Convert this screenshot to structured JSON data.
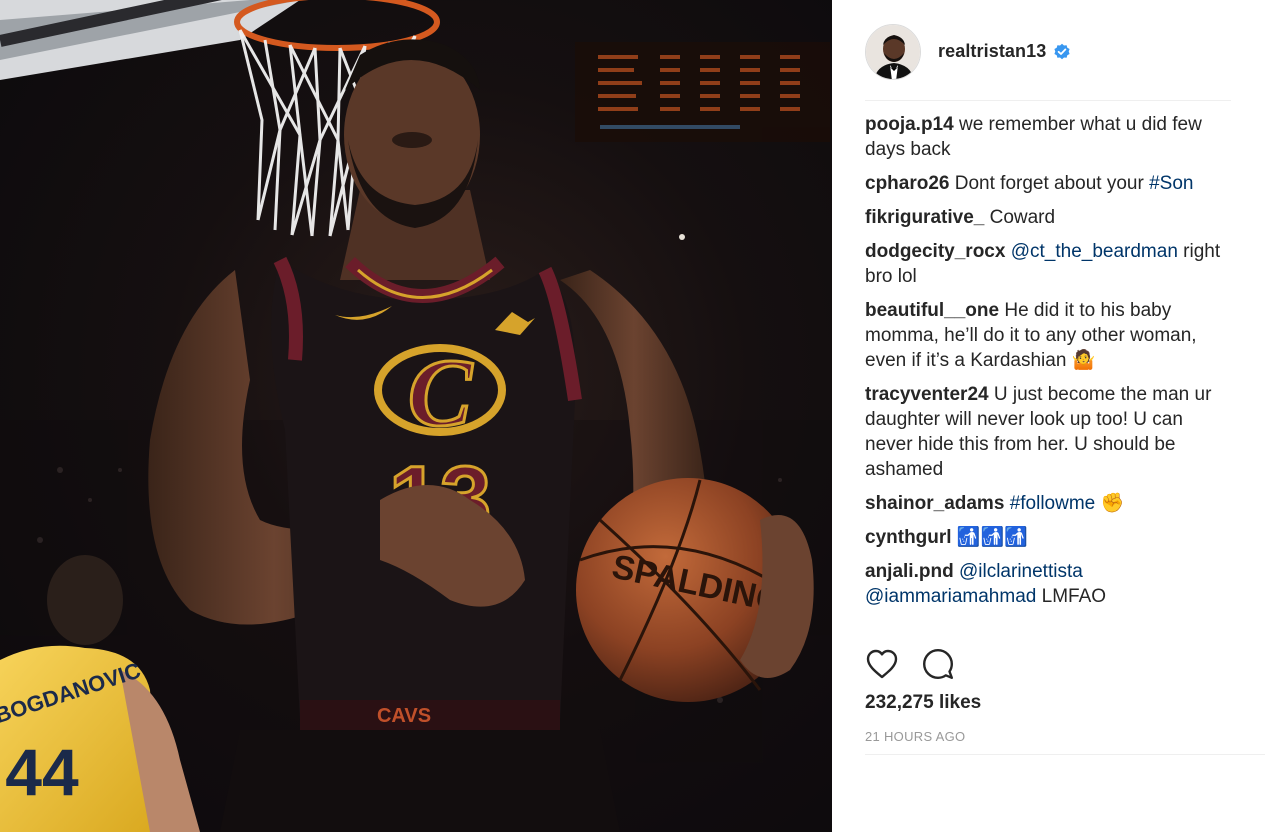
{
  "post": {
    "username": "realtristan13",
    "verified": true,
    "verified_icon": "verified-badge-icon",
    "likes": "232,275 likes",
    "time": "21 HOURS AGO",
    "photo": {
      "jersey_number": "13",
      "jersey_logo": "C",
      "shorts_text": "CAVS",
      "ball_brand": "SPALDING",
      "opponent_name": "BOGDANOVIC",
      "opponent_number": "44"
    }
  },
  "comments": [
    {
      "user": "pooja.p14",
      "parts": [
        {
          "t": "we remember what u did few days back"
        }
      ]
    },
    {
      "user": "cpharo26",
      "parts": [
        {
          "t": "Dont forget about your "
        },
        {
          "t": "#Son",
          "link": true
        }
      ]
    },
    {
      "user": "fikrigurative_",
      "parts": [
        {
          "t": "Coward"
        }
      ]
    },
    {
      "user": "dodgecity_rocx",
      "parts": [
        {
          "t": "@ct_the_beardman",
          "link": true
        },
        {
          "t": " right bro lol"
        }
      ]
    },
    {
      "user": "beautiful__one",
      "parts": [
        {
          "t": "He did it to his baby momma, he’ll do it to any other woman, even if it’s a Kardashian 🤷"
        }
      ]
    },
    {
      "user": "tracyventer24",
      "parts": [
        {
          "t": "U just become the man ur daughter will never look up too! U can never hide this from her. U should be ashamed"
        }
      ]
    },
    {
      "user": "shainor_adams",
      "parts": [
        {
          "t": "#followme",
          "link": true
        },
        {
          "t": " ✊"
        }
      ]
    },
    {
      "user": "cynthgurl",
      "parts": [
        {
          "t": "🚮🚮🚮"
        }
      ]
    },
    {
      "user": "anjali.pnd",
      "parts": [
        {
          "t": "@ilclarinettista",
          "link": true
        },
        {
          "t": " "
        },
        {
          "t": "@iammariamahmad",
          "link": true
        },
        {
          "t": " LMFAO"
        }
      ]
    }
  ],
  "actions": {
    "like_icon": "heart-icon",
    "comment_icon": "comment-bubble-icon"
  },
  "colors": {
    "text": "#262626",
    "link": "#003569",
    "muted": "#999999",
    "verified": "#3897f0",
    "jersey": "#1b1416",
    "wine": "#6b1d2a",
    "gold": "#d6a32b",
    "pacers_yellow": "#f2c22e"
  }
}
